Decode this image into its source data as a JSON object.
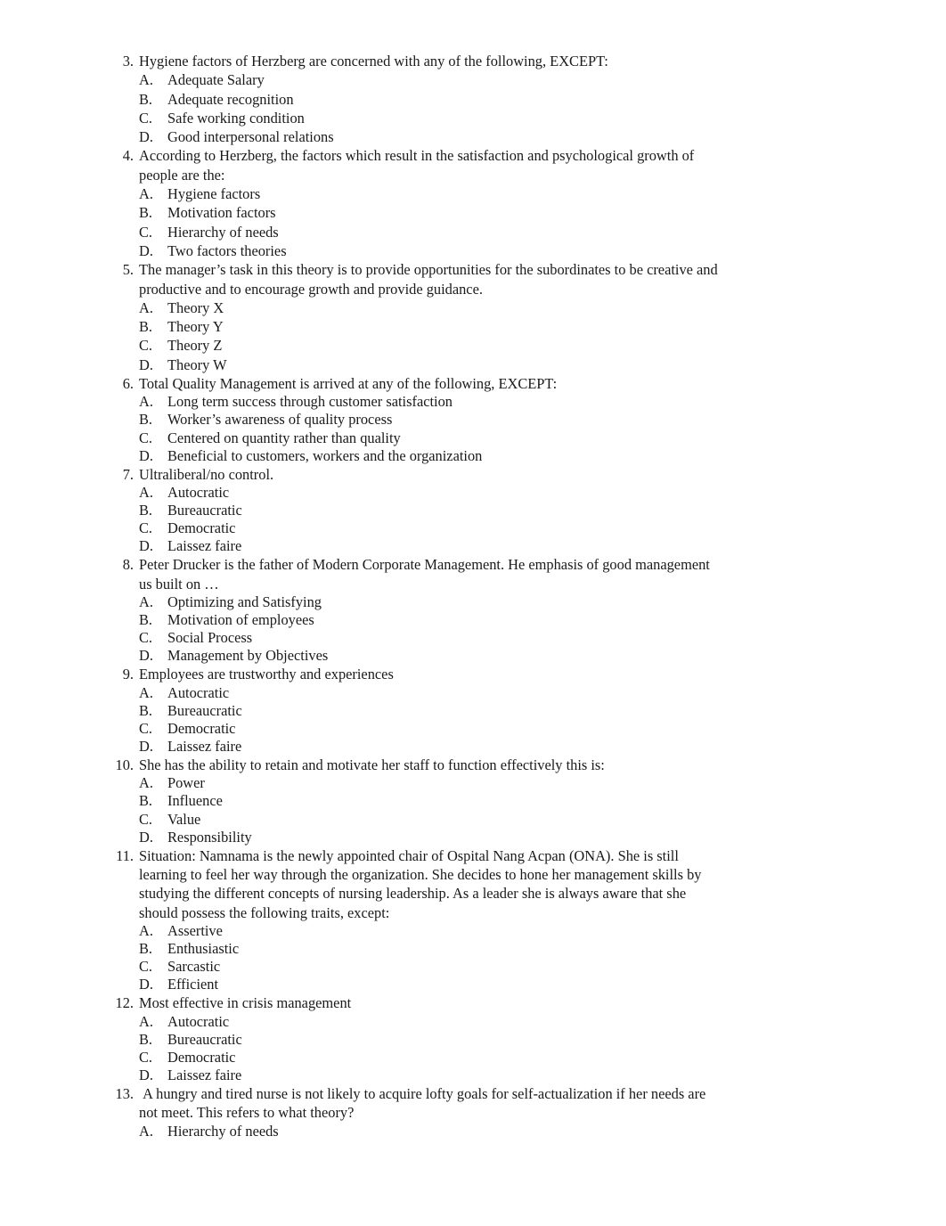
{
  "document": {
    "page_background": "#ffffff",
    "text_color": "#1a1a1a",
    "items": [
      {
        "number": "3.",
        "text": "Hygiene factors of Herzberg are concerned with any of the following, EXCEPT:",
        "spacing": "loose",
        "options": [
          {
            "letter": "A.",
            "text": "Adequate Salary"
          },
          {
            "letter": "B.",
            "text": "Adequate recognition"
          },
          {
            "letter": "C.",
            "text": "Safe working condition"
          },
          {
            "letter": "D.",
            "text": "Good interpersonal relations"
          }
        ]
      },
      {
        "number": "4.",
        "text": "According to Herzberg, the factors which result in the satisfaction and psychological growth of people are the:",
        "spacing": "loose",
        "options": [
          {
            "letter": "A.",
            "text": "Hygiene factors"
          },
          {
            "letter": "B.",
            "text": "Motivation factors"
          },
          {
            "letter": "C.",
            "text": "Hierarchy of needs"
          },
          {
            "letter": "D.",
            "text": "Two factors theories"
          }
        ]
      },
      {
        "number": "5.",
        "text": "The manager’s task in this theory is to provide opportunities for the subordinates to be creative and productive and to encourage growth and provide guidance.",
        "spacing": "loose",
        "options": [
          {
            "letter": "A.",
            "text": "Theory X"
          },
          {
            "letter": "B.",
            "text": "Theory Y"
          },
          {
            "letter": "C.",
            "text": "Theory Z"
          },
          {
            "letter": "D.",
            "text": "Theory W"
          }
        ]
      },
      {
        "number": "6.",
        "text": "Total Quality Management is arrived at any of the following, EXCEPT:",
        "spacing": "tight",
        "options": [
          {
            "letter": "A.",
            "text": "Long term success through customer satisfaction"
          },
          {
            "letter": "B.",
            "text": "Worker’s awareness of quality process"
          },
          {
            "letter": "C.",
            "text": "Centered on quantity rather than quality"
          },
          {
            "letter": "D.",
            "text": "Beneficial to customers, workers and the organization"
          }
        ]
      },
      {
        "number": "7.",
        "text": "Ultraliberal/no control.",
        "spacing": "tight",
        "options": [
          {
            "letter": "A.",
            "text": "Autocratic"
          },
          {
            "letter": "B.",
            "text": "Bureaucratic"
          },
          {
            "letter": "C.",
            "text": "Democratic"
          },
          {
            "letter": "D.",
            "text": "Laissez faire"
          }
        ]
      },
      {
        "number": "8.",
        "text": "Peter Drucker is the father of Modern Corporate Management. He emphasis of good management us built on …",
        "spacing": "tight",
        "options": [
          {
            "letter": "A.",
            "text": "Optimizing and Satisfying"
          },
          {
            "letter": "B.",
            "text": "Motivation of employees"
          },
          {
            "letter": "C.",
            "text": "Social Process"
          },
          {
            "letter": "D.",
            "text": "Management by Objectives"
          }
        ]
      },
      {
        "number": "9.",
        "text": "Employees are trustworthy and experiences",
        "spacing": "tight",
        "options": [
          {
            "letter": "A.",
            "text": "Autocratic"
          },
          {
            "letter": "B.",
            "text": "Bureaucratic"
          },
          {
            "letter": "C.",
            "text": "Democratic"
          },
          {
            "letter": "D.",
            "text": "Laissez faire"
          }
        ]
      },
      {
        "number": "10.",
        "text": "She has the ability to retain and motivate her staff to function effectively this is:",
        "spacing": "tight",
        "options": [
          {
            "letter": "A.",
            "text": "Power"
          },
          {
            "letter": "B.",
            "text": "Influence"
          },
          {
            "letter": "C.",
            "text": "Value"
          },
          {
            "letter": "D.",
            "text": "Responsibility"
          }
        ]
      },
      {
        "number": "11.",
        "text": "Situation: Namnama is the newly appointed chair of Ospital Nang Acpan (ONA). She is still learning to feel her way through the organization. She decides to hone her management skills by studying the different concepts of nursing leadership. As a leader she is always aware that she should possess the following traits, except:",
        "spacing": "tight",
        "options": [
          {
            "letter": "A.",
            "text": "Assertive"
          },
          {
            "letter": "B.",
            "text": "Enthusiastic"
          },
          {
            "letter": "C.",
            "text": "Sarcastic"
          },
          {
            "letter": "D.",
            "text": "Efficient"
          }
        ]
      },
      {
        "number": "12.",
        "text": "Most effective in crisis management",
        "spacing": "tight",
        "options": [
          {
            "letter": "A.",
            "text": "Autocratic"
          },
          {
            "letter": "B.",
            "text": "Bureaucratic"
          },
          {
            "letter": "C.",
            "text": "Democratic"
          },
          {
            "letter": "D.",
            "text": "Laissez faire"
          }
        ]
      },
      {
        "number": "13.",
        "text": " A hungry and tired nurse is not likely to acquire lofty goals for self-actualization if her needs are not meet. This refers to what theory?",
        "spacing": "tight",
        "options": [
          {
            "letter": "A.",
            "text": "Hierarchy of needs"
          }
        ]
      }
    ]
  }
}
